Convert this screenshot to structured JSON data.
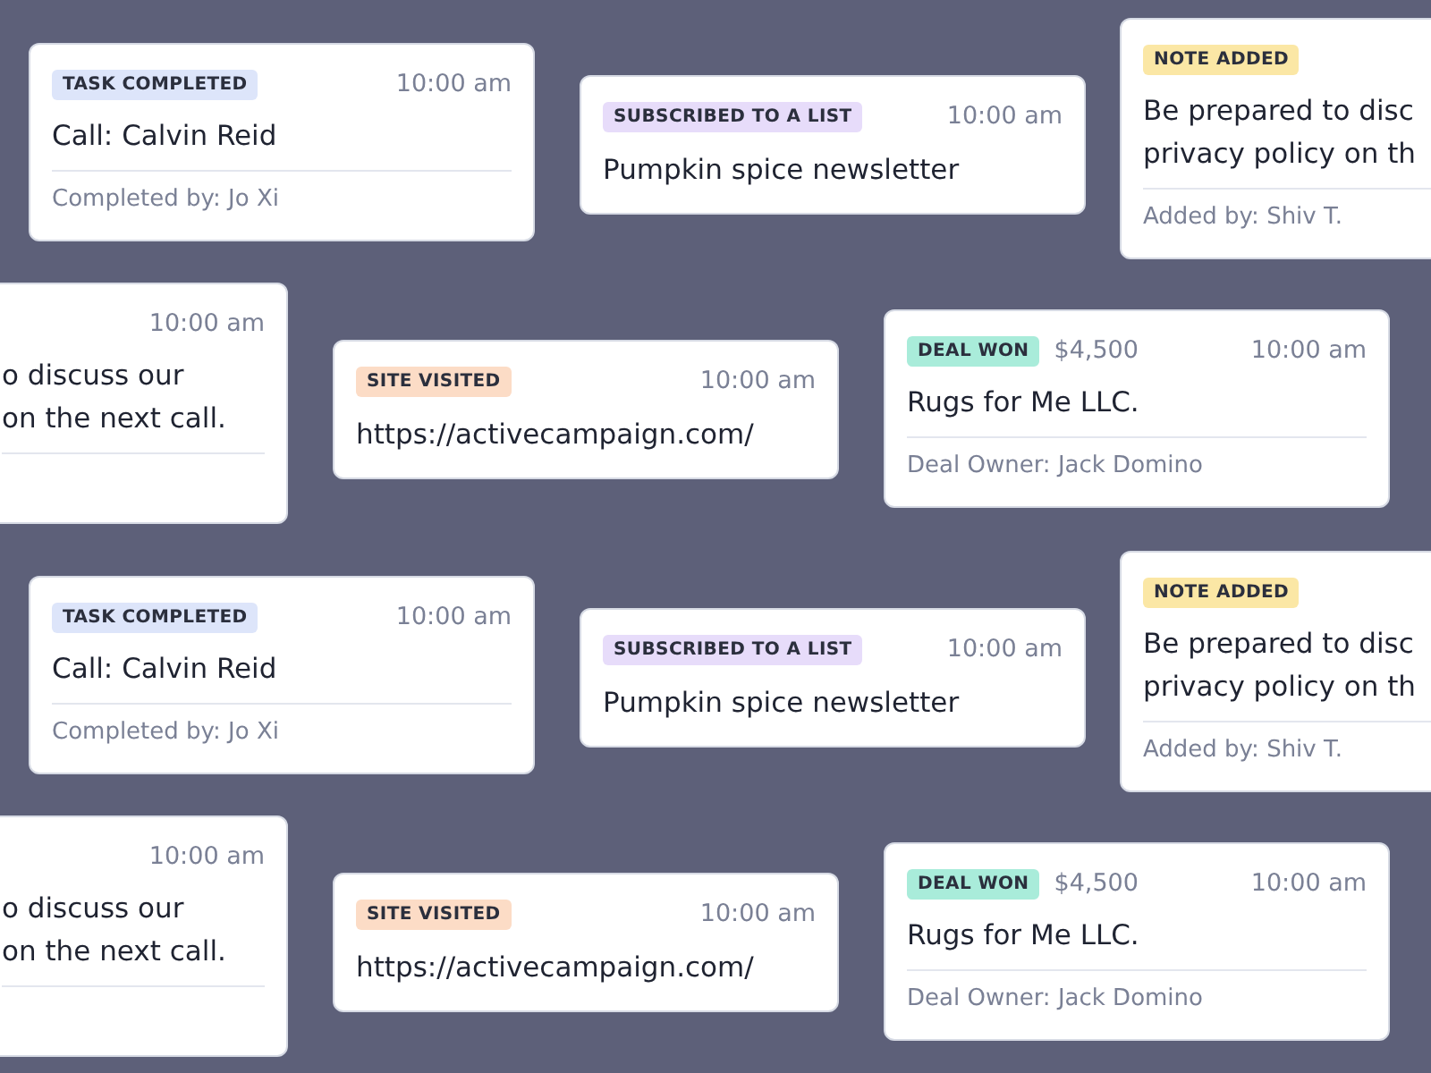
{
  "cards": [
    {
      "kind": "detail",
      "tag": {
        "label": "TASK COMPLETED",
        "color": "#dde5fa"
      },
      "time": "10:00 am",
      "lines": [
        "Call: Calvin Reid"
      ],
      "footer": "Completed by: Jo Xi"
    },
    {
      "kind": "simple",
      "tag": {
        "label": "SUBSCRIBED TO A LIST",
        "color": "#e7dcfa"
      },
      "time": "10:00 am",
      "lines": [
        "Pumpkin spice newsletter"
      ]
    },
    {
      "kind": "detail",
      "tag": {
        "label": "NOTE ADDED",
        "color": "#fbe7a5"
      },
      "lines": [
        "Be prepared to disc",
        "privacy policy on th"
      ],
      "footer": "Added by: Shiv T."
    },
    {
      "kind": "detail",
      "time": "10:00 am",
      "lines": [
        "o discuss our",
        "on the next call."
      ]
    },
    {
      "kind": "simple",
      "tag": {
        "label": "SITE VISITED",
        "color": "#fcdcc6"
      },
      "time": "10:00 am",
      "lines": [
        "https://activecampaign.com/"
      ]
    },
    {
      "kind": "detail",
      "tag": {
        "label": "DEAL WON",
        "color": "#a9ecda"
      },
      "amount": "$4,500",
      "time": "10:00 am",
      "lines": [
        "Rugs for Me LLC."
      ],
      "footer": "Deal Owner: Jack Domino"
    },
    {
      "kind": "detail",
      "tag": {
        "label": "TASK COMPLETED",
        "color": "#dde5fa"
      },
      "time": "10:00 am",
      "lines": [
        "Call: Calvin Reid"
      ],
      "footer": "Completed by: Jo Xi"
    },
    {
      "kind": "simple",
      "tag": {
        "label": "SUBSCRIBED TO A LIST",
        "color": "#e7dcfa"
      },
      "time": "10:00 am",
      "lines": [
        "Pumpkin spice newsletter"
      ]
    },
    {
      "kind": "detail",
      "tag": {
        "label": "NOTE ADDED",
        "color": "#fbe7a5"
      },
      "lines": [
        "Be prepared to disc",
        "privacy policy on th"
      ],
      "footer": "Added by: Shiv T."
    },
    {
      "kind": "detail",
      "time": "10:00 am",
      "lines": [
        "o discuss our",
        "on the next call."
      ]
    },
    {
      "kind": "simple",
      "tag": {
        "label": "SITE VISITED",
        "color": "#fcdcc6"
      },
      "time": "10:00 am",
      "lines": [
        "https://activecampaign.com/"
      ]
    },
    {
      "kind": "detail",
      "tag": {
        "label": "DEAL WON",
        "color": "#a9ecda"
      },
      "amount": "$4,500",
      "time": "10:00 am",
      "lines": [
        "Rugs for Me LLC."
      ],
      "footer": "Deal Owner: Jack Domino"
    }
  ]
}
